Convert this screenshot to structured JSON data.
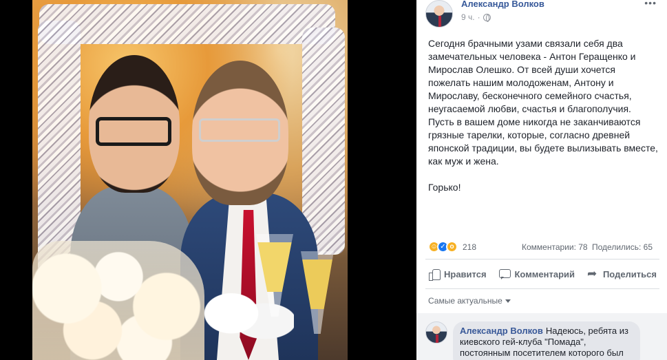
{
  "post": {
    "author": "Александр Волков",
    "time": "9 ч.",
    "menu_label": "•••",
    "text": "Сегодня брачными узами связали себя два замечательных человека - Антон Геращенко и Мирослав Олешко. От всей души хочется пожелать нашим молодоженам, Антону и Мирославу, бесконечного семейного счастья, неугасаемой любви, счастья и благополучия. Пусть в вашем доме никогда не заканчиваются грязные тарелки, которые, согласно древней японской традиции, вы будете вылизывать вместе, как муж и жена.\n\nГорько!",
    "reactions": {
      "icons": [
        "haha-icon",
        "like-icon",
        "wow-icon"
      ],
      "count": "218",
      "comments": "Комментарии: 78",
      "shares": "Поделились: 65"
    },
    "actions": {
      "like": "Нравится",
      "comment": "Комментарий",
      "share": "Поделиться"
    },
    "sort_label": "Самые актуальные"
  },
  "comments": [
    {
      "author": "Александр Волков",
      "text": "Надеюсь, ребята из киевского гей-клуба \"Помада\", постоянным посетителем которого был"
    }
  ],
  "colors": {
    "link": "#365899",
    "meta": "#90949c",
    "panel": "#ffffff",
    "comments_bg": "#f2f3f5"
  }
}
